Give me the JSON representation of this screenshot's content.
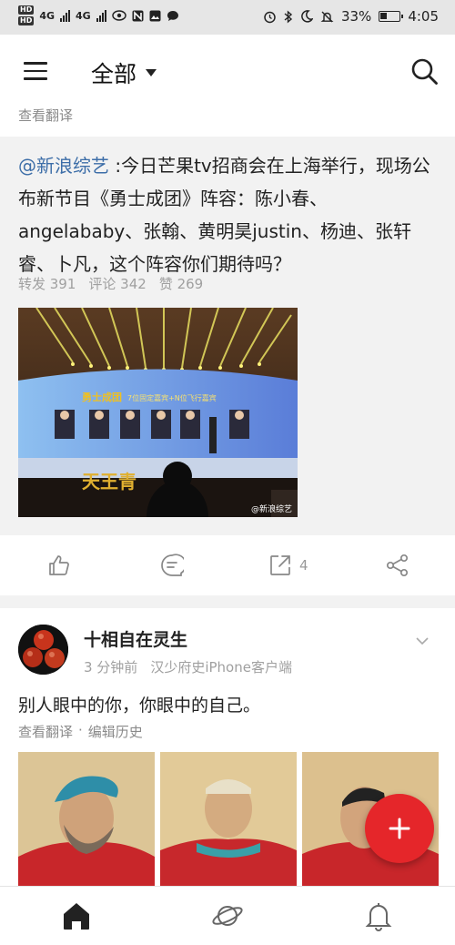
{
  "status_bar": {
    "network_a": "4G",
    "network_b": "4G",
    "battery": "33%",
    "time": "4:05"
  },
  "header": {
    "title": "全部"
  },
  "top_post": {
    "translate": "查看翻译"
  },
  "repost": {
    "mention": "@新浪综艺",
    "text": " :今日芒果tv招商会在上海举行，现场公布新节目《勇士成团》阵容：陈小春、angelababy、张翰、黄明昊justin、杨迪、张轩睿、卜凡，这个阵容你们期待吗？",
    "stats": {
      "repost": "转发 391",
      "comment": "评论 342",
      "like": "赞 269"
    },
    "image": {
      "banner_title": "勇士成团",
      "banner_sub": "7位固定嘉宾+N位飞行嘉宾",
      "stage_text": "天王青",
      "watermark": "@新浪综艺"
    }
  },
  "actions": {
    "share_count": "4"
  },
  "post2": {
    "username": "十相自在灵生",
    "time": "3 分钟前",
    "source": "汉少府史iPhone客户端",
    "text": "别人眼中的你，你眼中的自己。",
    "translate": "查看翻译",
    "separator": "·",
    "edit_history": "编辑历史"
  },
  "colors": {
    "accent_red": "#e5262a",
    "link_blue": "#3d6ea8"
  }
}
